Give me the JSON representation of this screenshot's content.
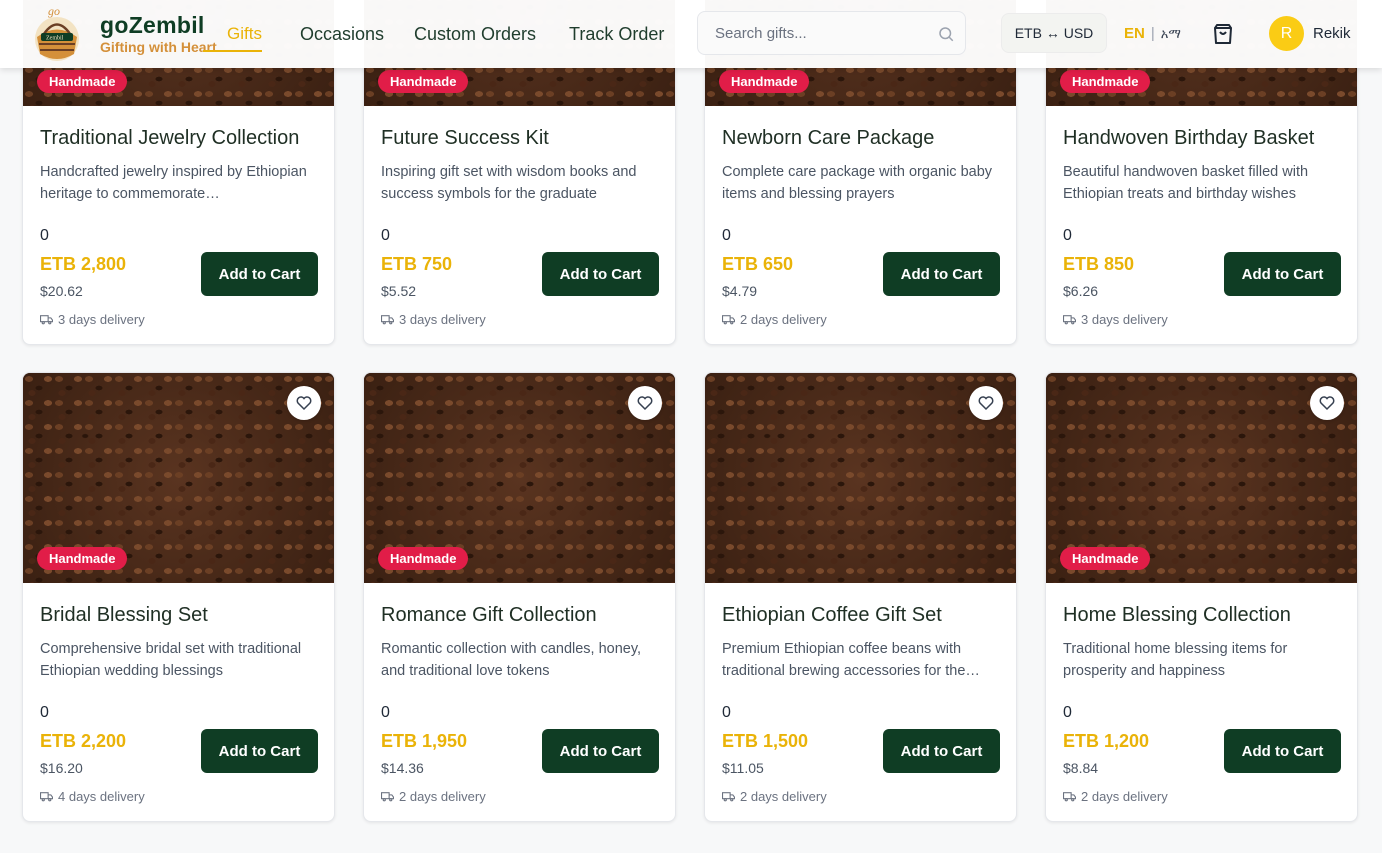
{
  "header": {
    "brand_name": "goZembil",
    "brand_tagline": "Gifting with Heart",
    "nav": [
      "Gifts",
      "Occasions",
      "Custom Orders",
      "Track Order"
    ],
    "search_placeholder": "Search gifts...",
    "currency_toggle": "ETB ↔ USD",
    "lang_en": "EN",
    "lang_separator": "|",
    "lang_am": "አማ",
    "user_initial": "R",
    "user_name": "Rekik"
  },
  "colors": {
    "brand_green": "#0f3d24",
    "accent_gold": "#eab308",
    "badge_red": "#e11d48"
  },
  "products": [
    {
      "title": "Traditional Jewelry Collection",
      "desc": "Handcrafted jewelry inspired by Ethiopian heritage to commemorate…",
      "rating": "0",
      "etb": "ETB 2,800",
      "usd": "$20.62",
      "delivery": "3 days delivery",
      "badge": "Handmade",
      "button": "Add to Cart"
    },
    {
      "title": "Future Success Kit",
      "desc": "Inspiring gift set with wisdom books and success symbols for the graduate",
      "rating": "0",
      "etb": "ETB 750",
      "usd": "$5.52",
      "delivery": "3 days delivery",
      "badge": "Handmade",
      "button": "Add to Cart"
    },
    {
      "title": "Newborn Care Package",
      "desc": "Complete care package with organic baby items and blessing prayers",
      "rating": "0",
      "etb": "ETB 650",
      "usd": "$4.79",
      "delivery": "2 days delivery",
      "badge": "Handmade",
      "button": "Add to Cart"
    },
    {
      "title": "Handwoven Birthday Basket",
      "desc": "Beautiful handwoven basket filled with Ethiopian treats and birthday wishes",
      "rating": "0",
      "etb": "ETB 850",
      "usd": "$6.26",
      "delivery": "3 days delivery",
      "badge": "Handmade",
      "button": "Add to Cart"
    },
    {
      "title": "Bridal Blessing Set",
      "desc": "Comprehensive bridal set with traditional Ethiopian wedding blessings",
      "rating": "0",
      "etb": "ETB 2,200",
      "usd": "$16.20",
      "delivery": "4 days delivery",
      "badge": "Handmade",
      "button": "Add to Cart"
    },
    {
      "title": "Romance Gift Collection",
      "desc": "Romantic collection with candles, honey, and traditional love tokens",
      "rating": "0",
      "etb": "ETB 1,950",
      "usd": "$14.36",
      "delivery": "2 days delivery",
      "badge": "Handmade",
      "button": "Add to Cart"
    },
    {
      "title": "Ethiopian Coffee Gift Set",
      "desc": "Premium Ethiopian coffee beans with traditional brewing accessories for the…",
      "rating": "0",
      "etb": "ETB 1,500",
      "usd": "$11.05",
      "delivery": "2 days delivery",
      "badge": "",
      "button": "Add to Cart"
    },
    {
      "title": "Home Blessing Collection",
      "desc": "Traditional home blessing items for prosperity and happiness",
      "rating": "0",
      "etb": "ETB 1,200",
      "usd": "$8.84",
      "delivery": "2 days delivery",
      "badge": "Handmade",
      "button": "Add to Cart"
    }
  ]
}
